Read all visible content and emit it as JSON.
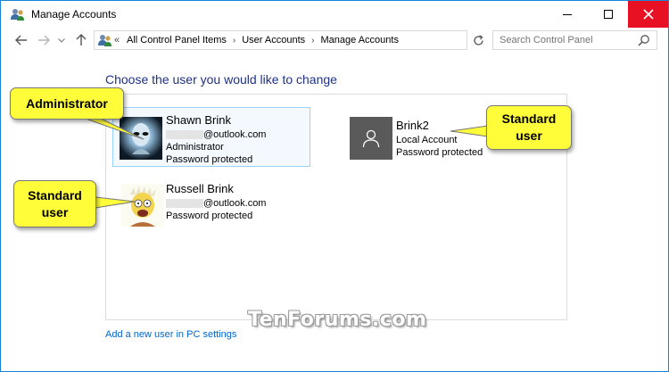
{
  "window": {
    "title": "Manage Accounts"
  },
  "nav": {
    "breadcrumb_overflow": "«",
    "breadcrumbs": [
      "All Control Panel Items",
      "User Accounts",
      "Manage Accounts"
    ],
    "search_placeholder": "Search Control Panel"
  },
  "main": {
    "heading": "Choose the user you would like to change",
    "accounts": [
      {
        "name": "Shawn Brink",
        "email_suffix": "@outlook.com",
        "role": "Administrator",
        "status": "Password protected",
        "selected": true
      },
      {
        "name": "Brink2",
        "account_type": "Local Account",
        "status": "Password protected"
      },
      {
        "name": "Russell Brink",
        "email_suffix": "@outlook.com",
        "status": "Password protected"
      }
    ],
    "add_user_link": "Add a new user in PC settings"
  },
  "watermark": "TenForums.com",
  "callouts": {
    "administrator": "Administrator",
    "standard_right_line1": "Standard",
    "standard_right_line2": "user",
    "standard_left_line1": "Standard",
    "standard_left_line2": "user"
  },
  "colors": {
    "heading": "#1e3287",
    "link": "#0066cc",
    "close_button": "#e81123",
    "callout_fill": "#fffc3a",
    "selection_border": "#99d1ff"
  },
  "icons": {
    "app": "users-control-panel-icon",
    "back": "arrow-left-icon",
    "forward": "arrow-right-icon",
    "up": "arrow-up-icon",
    "refresh": "refresh-icon",
    "search": "search-icon",
    "default_user": "person-icon"
  }
}
